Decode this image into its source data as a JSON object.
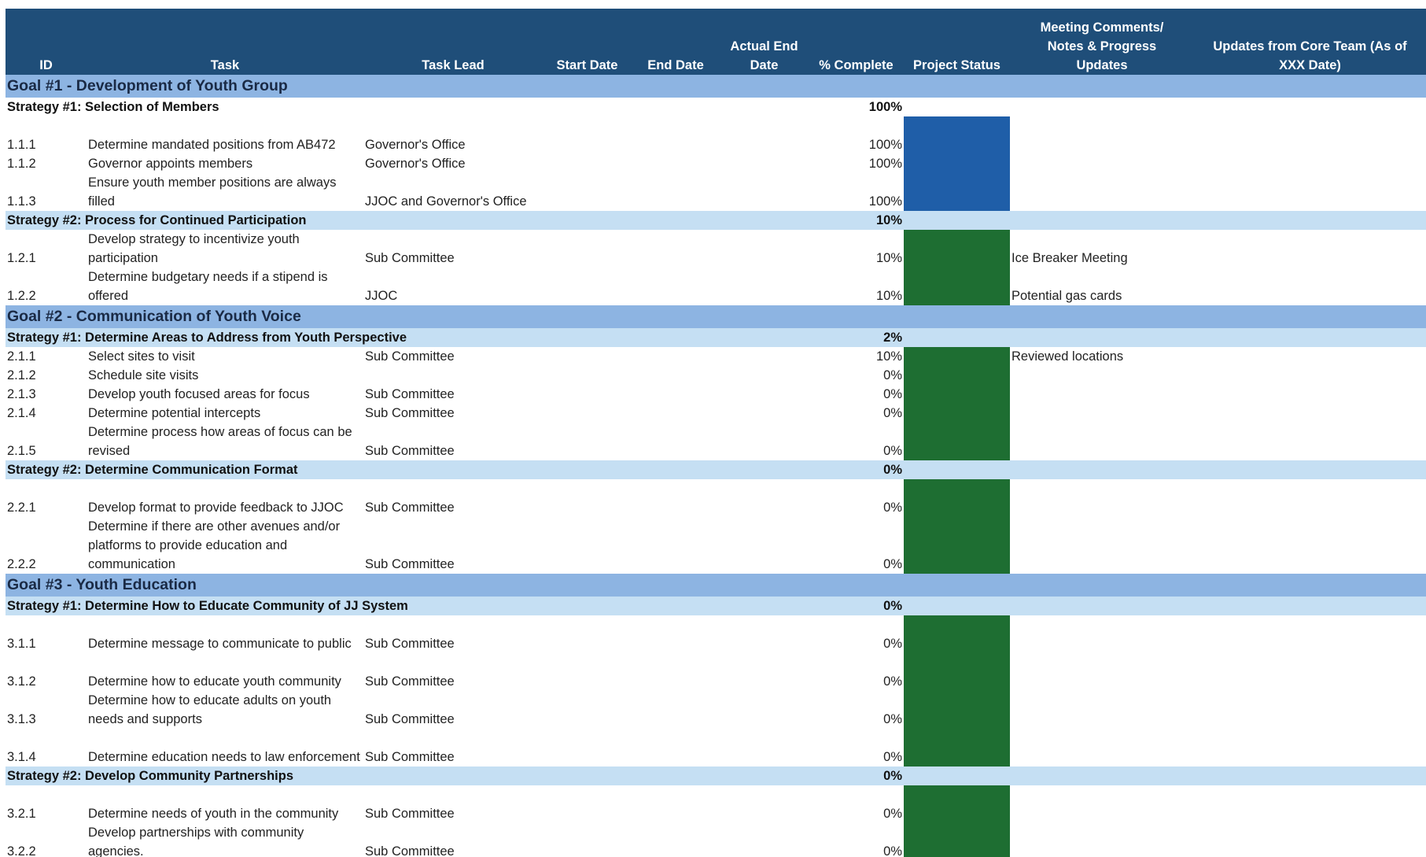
{
  "columns": {
    "id": "ID",
    "task": "Task",
    "task_lead": "Task Lead",
    "start_date": "Start Date",
    "end_date": "End Date",
    "actual_end_line1": "Actual End",
    "actual_end_line2": "Date",
    "pct_complete": "% Complete",
    "project_status": "Project Status",
    "meeting_line1": "Meeting Comments/",
    "meeting_line2": "Notes & Progress",
    "meeting_line3": "Updates",
    "updates_line1": "Updates from Core Team (As of",
    "updates_line2": "XXX Date)"
  },
  "colors": {
    "header_bg": "#1f4e79",
    "goal_bg": "#8db4e2",
    "strategy_bg": "#c5dff3",
    "status_complete": "#1f5ea8",
    "status_on_track": "#1e6e32"
  },
  "goals": [
    {
      "title": "Goal #1 - Development of Youth Group",
      "strategies": [
        {
          "title": "Strategy #1: Selection of Members",
          "pct": "100%",
          "tasks": [
            {
              "id": "1.1.1",
              "task": "Determine mandated positions from AB472",
              "lead": "Governor's Office",
              "pct": "100%",
              "notes": ""
            },
            {
              "id": "1.1.2",
              "task": "Governor appoints members",
              "lead": "Governor's Office",
              "pct": "100%",
              "notes": ""
            },
            {
              "id": "1.1.3",
              "task": "Ensure youth member positions are always filled",
              "lead": "JJOC and Governor's Office",
              "pct": "100%",
              "notes": ""
            }
          ]
        },
        {
          "title": "Strategy #2: Process for Continued Participation",
          "pct": "10%",
          "tasks": [
            {
              "id": "1.2.1",
              "task": "Develop strategy to incentivize youth participation",
              "lead": "Sub Committee",
              "pct": "10%",
              "notes": "Ice Breaker Meeting"
            },
            {
              "id": "1.2.2",
              "task": "Determine budgetary needs if a stipend is offered",
              "lead": "JJOC",
              "pct": "10%",
              "notes": "Potential gas cards"
            }
          ]
        }
      ]
    },
    {
      "title": "Goal #2 - Communication of Youth Voice",
      "strategies": [
        {
          "title": "Strategy #1: Determine Areas to Address from Youth Perspective",
          "pct": "2%",
          "tasks": [
            {
              "id": "2.1.1",
              "task": "Select sites to visit",
              "lead": "Sub Committee",
              "pct": "10%",
              "notes": "Reviewed locations"
            },
            {
              "id": "2.1.2",
              "task": "Schedule site visits",
              "lead": "",
              "pct": "0%",
              "notes": ""
            },
            {
              "id": "2.1.3",
              "task": "Develop youth focused areas for focus",
              "lead": "Sub Committee",
              "pct": "0%",
              "notes": ""
            },
            {
              "id": "2.1.4",
              "task": "Determine potential intercepts",
              "lead": "Sub Committee",
              "pct": "0%",
              "notes": ""
            },
            {
              "id": "2.1.5",
              "task": "Determine process how areas of focus can be revised",
              "lead": "Sub Committee",
              "pct": "0%",
              "notes": ""
            }
          ]
        },
        {
          "title": "Strategy #2: Determine Communication Format",
          "pct": "0%",
          "tasks": [
            {
              "id": "2.2.1",
              "task": "Develop format to provide feedback to JJOC",
              "lead": "Sub Committee",
              "pct": "0%",
              "notes": ""
            },
            {
              "id": "2.2.2",
              "task": "Determine if there are other avenues and/or platforms to provide education and communication",
              "lead": "Sub Committee",
              "pct": "0%",
              "notes": ""
            }
          ]
        }
      ]
    },
    {
      "title": "Goal #3 - Youth Education",
      "strategies": [
        {
          "title": "Strategy #1: Determine How to Educate Community of JJ System",
          "pct": "0%",
          "tasks": [
            {
              "id": "3.1.1",
              "task": "Determine message to communicate to public",
              "lead": "Sub Committee",
              "pct": "0%",
              "notes": ""
            },
            {
              "id": "3.1.2",
              "task": "Determine how to educate youth community",
              "lead": "Sub Committee",
              "pct": "0%",
              "notes": ""
            },
            {
              "id": "3.1.3",
              "task": "Determine how to educate adults on youth needs and supports",
              "lead": "Sub Committee",
              "pct": "0%",
              "notes": ""
            },
            {
              "id": "3.1.4",
              "task": "Determine education needs to law enforcement",
              "lead": "Sub Committee",
              "pct": "0%",
              "notes": ""
            }
          ]
        },
        {
          "title": "Strategy #2: Develop Community Partnerships",
          "pct": "0%",
          "tasks": [
            {
              "id": "3.2.1",
              "task": "Determine needs of youth in the community",
              "lead": "Sub Committee",
              "pct": "0%",
              "notes": ""
            },
            {
              "id": "3.2.2",
              "task": "Develop partnerships with community agencies.",
              "lead": "Sub Committee",
              "pct": "0%",
              "notes": ""
            }
          ]
        }
      ]
    }
  ]
}
